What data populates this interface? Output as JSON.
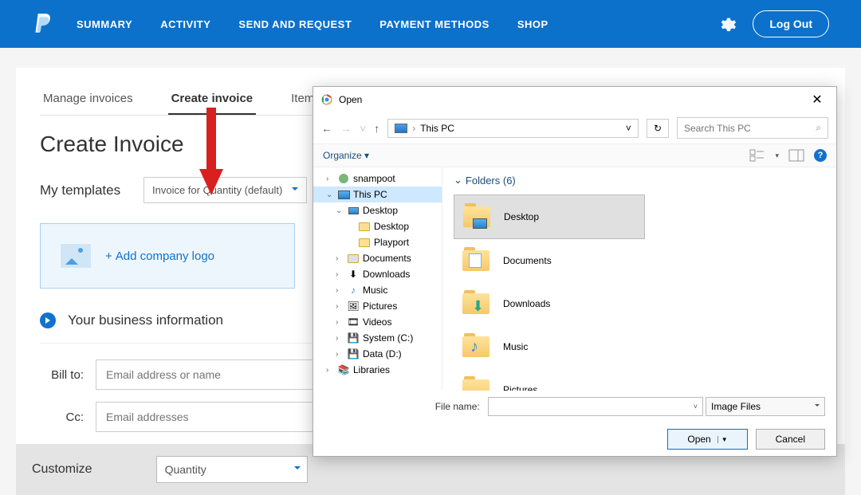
{
  "nav": {
    "summary": "SUMMARY",
    "activity": "ACTIVITY",
    "send": "SEND AND REQUEST",
    "payment": "PAYMENT METHODS",
    "shop": "SHOP",
    "logout": "Log Out"
  },
  "tabs": {
    "manage": "Manage invoices",
    "create": "Create invoice",
    "items": "Items"
  },
  "page": {
    "title": "Create Invoice",
    "templates_label": "My templates",
    "template_selected": "Invoice for Quantity (default)",
    "add_logo": "Add company logo",
    "biz_info": "Your business information",
    "bill_to_label": "Bill to:",
    "bill_to_placeholder": "Email address or name",
    "cc_label": "Cc:",
    "cc_placeholder": "Email addresses",
    "customize_label": "Customize",
    "customize_value": "Quantity"
  },
  "dialog": {
    "title": "Open",
    "breadcrumb": "This PC",
    "search_placeholder": "Search This PC",
    "organize": "Organize",
    "tree": {
      "user": "snampoot",
      "thispc": "This PC",
      "desktop1": "Desktop",
      "desktop2": "Desktop",
      "playport": "Playport",
      "documents": "Documents",
      "downloads": "Downloads",
      "music": "Music",
      "pictures": "Pictures",
      "videos": "Videos",
      "systemc": "System (C:)",
      "datad": "Data (D:)",
      "libraries": "Libraries"
    },
    "content_header": "Folders (6)",
    "folders": {
      "desktop": "Desktop",
      "documents": "Documents",
      "downloads": "Downloads",
      "music": "Music",
      "pictures": "Pictures"
    },
    "filename_label": "File name:",
    "filetype": "Image Files",
    "open_btn": "Open",
    "cancel_btn": "Cancel"
  }
}
